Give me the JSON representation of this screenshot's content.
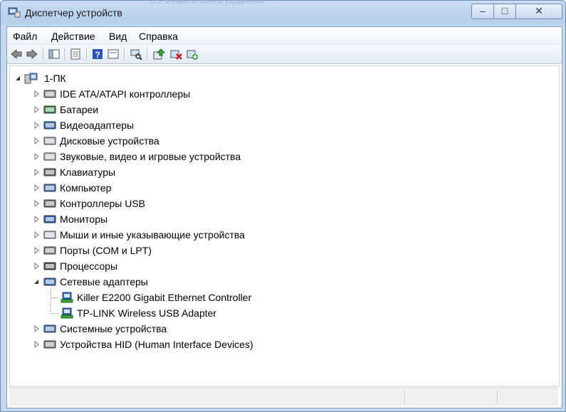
{
  "window": {
    "title": "Диспетчер устройств",
    "ghost_text": "Все элементы панели управления"
  },
  "window_buttons": {
    "minimize": "‒",
    "maximize": "□",
    "close": "✕"
  },
  "menu": {
    "items": [
      "Файл",
      "Действие",
      "Вид",
      "Справка"
    ]
  },
  "toolbar": {
    "icons": [
      "back-icon",
      "forward-icon",
      "console-tree-icon",
      "properties-icon",
      "help-icon",
      "view-icon",
      "scan-hardware-icon",
      "update-driver-icon",
      "uninstall-icon",
      "enable-device-icon"
    ]
  },
  "tree": {
    "root": "1-ПК",
    "categories": [
      {
        "label": "IDE ATA/ATAPI контроллеры",
        "icon": "ide-controller-icon"
      },
      {
        "label": "Батареи",
        "icon": "battery-icon"
      },
      {
        "label": "Видеоадаптеры",
        "icon": "display-adapter-icon"
      },
      {
        "label": "Дисковые устройства",
        "icon": "disk-drive-icon"
      },
      {
        "label": "Звуковые, видео и игровые устройства",
        "icon": "sound-icon"
      },
      {
        "label": "Клавиатуры",
        "icon": "keyboard-icon"
      },
      {
        "label": "Компьютер",
        "icon": "computer-icon"
      },
      {
        "label": "Контроллеры USB",
        "icon": "usb-icon"
      },
      {
        "label": "Мониторы",
        "icon": "monitor-icon"
      },
      {
        "label": "Мыши и иные указывающие устройства",
        "icon": "mouse-icon"
      },
      {
        "label": "Порты (COM и LPT)",
        "icon": "port-icon"
      },
      {
        "label": "Процессоры",
        "icon": "processor-icon"
      },
      {
        "label": "Сетевые адаптеры",
        "icon": "network-adapter-icon"
      },
      {
        "label": "Системные устройства",
        "icon": "system-device-icon"
      },
      {
        "label": "Устройства HID (Human Interface Devices)",
        "icon": "hid-icon"
      }
    ],
    "network_children": [
      "Killer E2200 Gigabit Ethernet Controller",
      "TP-LINK Wireless USB Adapter"
    ]
  }
}
